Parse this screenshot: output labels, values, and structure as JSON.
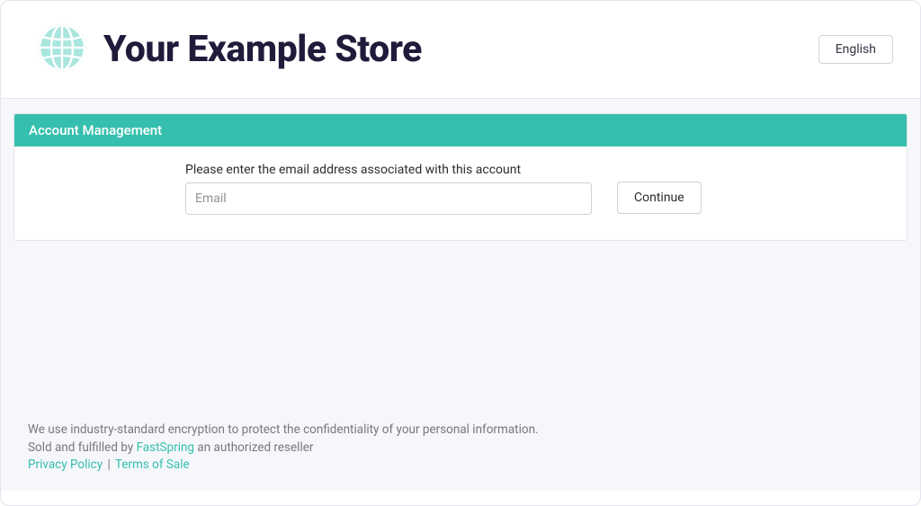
{
  "brand": {
    "title": "Your Example Store"
  },
  "header": {
    "language_label": "English"
  },
  "panel": {
    "title": "Account Management",
    "prompt": "Please enter the email address associated with this account",
    "email_placeholder": "Email",
    "continue_label": "Continue"
  },
  "footer": {
    "line1": "We use industry-standard encryption to protect the confidentiality of your personal information.",
    "line2_prefix": "Sold and fulfilled by ",
    "line2_link": "FastSpring",
    "line2_suffix": " an authorized reseller",
    "privacy_label": "Privacy Policy",
    "divider": "|",
    "terms_label": "Terms of Sale"
  },
  "colors": {
    "accent": "#36bfae",
    "brand_text": "#1f1c3b"
  }
}
